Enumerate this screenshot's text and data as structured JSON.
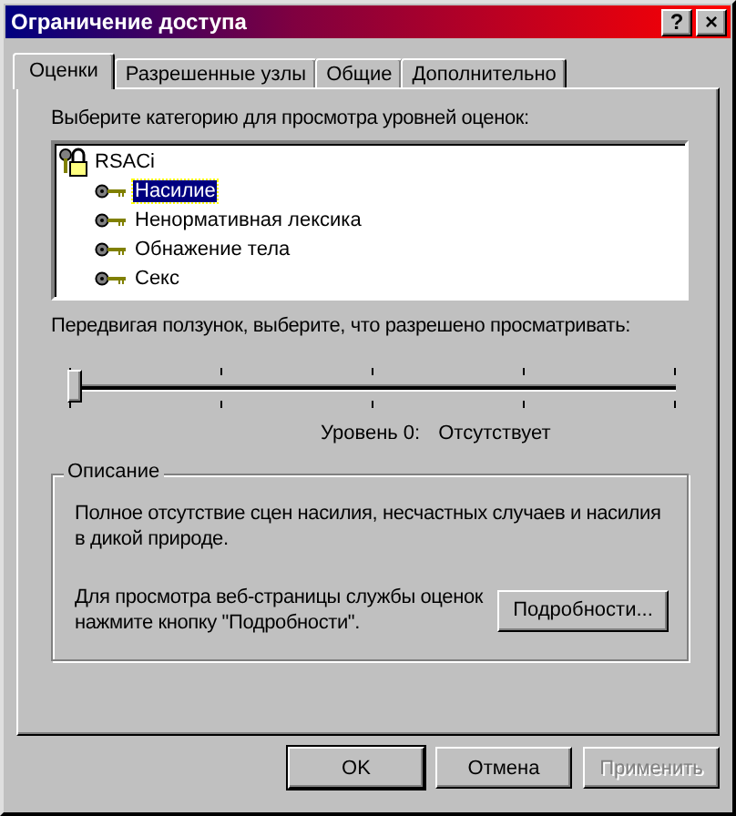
{
  "window": {
    "title": "Ограничение доступа",
    "title_buttons": [
      "?",
      "×"
    ]
  },
  "tabs": [
    {
      "label": "Оценки",
      "selected": true
    },
    {
      "label": "Разрешенные узлы",
      "selected": false
    },
    {
      "label": "Общие",
      "selected": false
    },
    {
      "label": "Дополнительно",
      "selected": false
    }
  ],
  "category_label": "Выберите категорию для просмотра уровней оценок:",
  "tree": [
    {
      "label": "RSACi",
      "kind": "system",
      "selected": false,
      "children": [
        {
          "label": "Насилие",
          "kind": "category",
          "selected": true
        },
        {
          "label": "Ненормативная лексика",
          "kind": "category",
          "selected": false
        },
        {
          "label": "Обнажение тела",
          "kind": "category",
          "selected": false
        },
        {
          "label": "Секс",
          "kind": "category",
          "selected": false
        }
      ]
    }
  ],
  "slider_label": "Передвигая ползунок, выберите, что разрешено просматривать:",
  "slider": {
    "level": 0
  },
  "level_caption": "Уровень 0:",
  "level_name": "Отсутствует",
  "description": {
    "title": "Описание",
    "text": "Полное отсутствие сцен насилия, несчастных случаев и насилия в дикой природе.",
    "hint": "Для просмотра веб-страницы службы оценок нажмите кнопку \"Подробности\".",
    "button": "Подробности..."
  },
  "buttons": [
    {
      "label": "OK",
      "disabled": false,
      "default": true
    },
    {
      "label": "Отмена",
      "disabled": false,
      "default": false
    },
    {
      "label": "Применить",
      "disabled": true,
      "default": false
    }
  ]
}
